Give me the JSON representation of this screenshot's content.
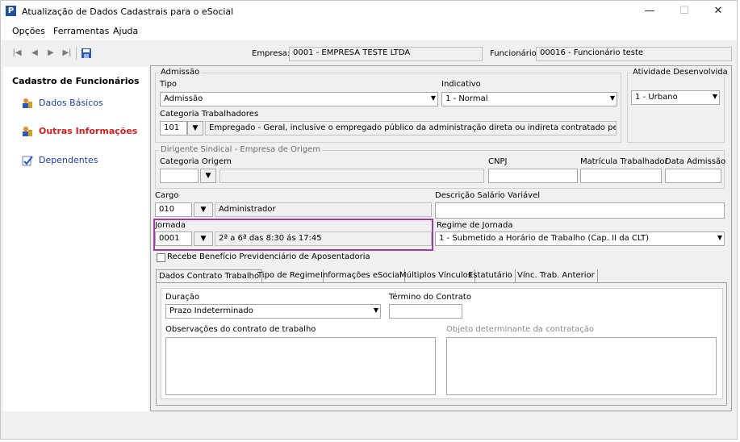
{
  "window": {
    "title": "Atualização de Dados Cadastrais para o eSocial",
    "app_icon": "P",
    "controls": {
      "minimize": "—",
      "maximize": "☐",
      "close": "✕"
    }
  },
  "menu": [
    "Opções",
    "Ferramentas",
    "Ajuda"
  ],
  "toolbar": {
    "first": "|◀",
    "prev": "◀",
    "next": "▶",
    "last": "▶|",
    "save": "save-icon"
  },
  "header": {
    "empresa_label": "Empresa:",
    "empresa_value": "0001 - EMPRESA TESTE LTDA",
    "funcionario_label": "Funcionário:",
    "funcionario_value": "00016 - Funcionário teste"
  },
  "sidebar": {
    "title": "Cadastro de Funcionários",
    "items": [
      {
        "label": "Dados Básicos",
        "active": false
      },
      {
        "label": "Outras Informações",
        "active": true
      },
      {
        "label": "Dependentes",
        "active": false
      }
    ]
  },
  "admissao": {
    "group_label": "Admissão",
    "tipo_label": "Tipo",
    "tipo_value": "Admissão",
    "indicativo_label": "Indicativo",
    "indicativo_value": "1 - Normal",
    "categoria_label": "Categoria Trabalhadores",
    "categoria_code": "101",
    "categoria_desc": "Empregado - Geral, inclusive o empregado público da administração direta ou indireta contratado pela CLT"
  },
  "atividade": {
    "group_label": "Atividade Desenvolvida",
    "value": "1 - Urbano"
  },
  "dirigente": {
    "group_label": "Dirigente Sindical - Empresa de Origem",
    "categoria_origem_label": "Categoria Origem",
    "cnpj_label": "CNPJ",
    "matricula_label": "Matrícula Trabalhador",
    "data_admissao_label": "Data Admissão"
  },
  "cargo": {
    "label": "Cargo",
    "code": "010",
    "desc": "Administrador"
  },
  "descricao_salario": {
    "label": "Descrição Salário Variável",
    "value": ""
  },
  "jornada": {
    "label": "Jornada",
    "code": "0001",
    "desc": "2ª a 6ª das 8:30 ás 17:45"
  },
  "regime_jornada": {
    "label": "Regime de Jornada",
    "value": "1 - Submetido a Horário de Trabalho (Cap. II da CLT)"
  },
  "beneficio": {
    "label": "Recebe Benefício Previdenciário de Aposentadoria",
    "checked": false
  },
  "tabs": [
    {
      "label": "Dados Contrato Trabalho",
      "active": true
    },
    {
      "label": "Tipo de Regime",
      "active": false
    },
    {
      "label": "Informações eSocial",
      "active": false
    },
    {
      "label": "Múltiplos Vínculos",
      "active": false
    },
    {
      "label": "Estatutário",
      "active": false
    },
    {
      "label": "Vínc. Trab. Anterior",
      "active": false
    }
  ],
  "contrato": {
    "duracao_label": "Duração",
    "duracao_value": "Prazo Indeterminado",
    "termino_label": "Término do Contrato",
    "observacoes_label": "Observações do contrato de trabalho",
    "objeto_label": "Objeto determinante da contratação"
  },
  "colors": {
    "highlight": "#9b3fa4",
    "link": "#1a3fa8",
    "active_link": "#d42020"
  }
}
